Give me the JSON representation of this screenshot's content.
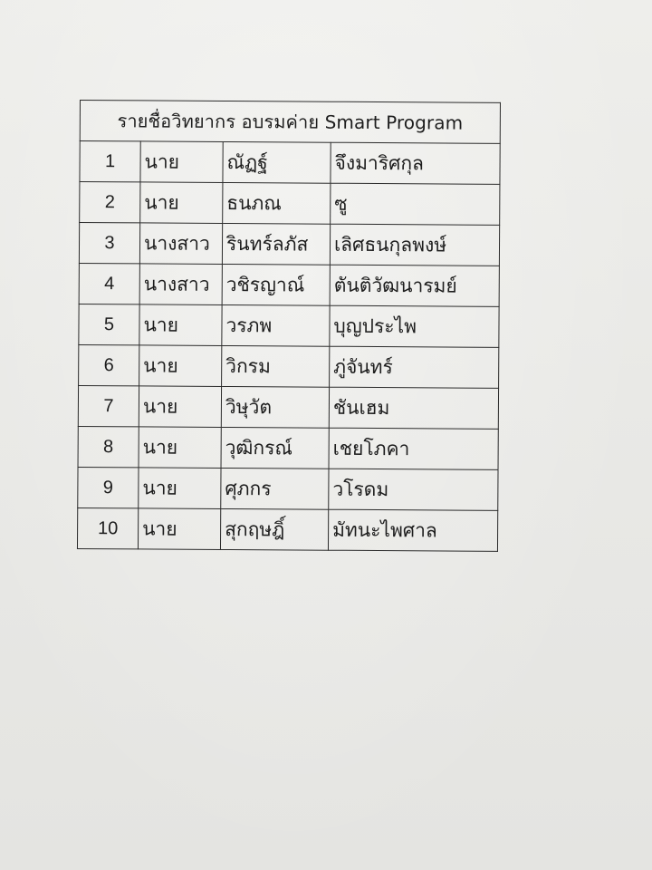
{
  "document": {
    "title": "รายชื่อวิทยากร อบรมค่าย Smart Program",
    "rows": [
      {
        "no": "1",
        "prefix": "นาย",
        "first_name": "ณัฏฐ์",
        "last_name": "จึงมาริศกุล"
      },
      {
        "no": "2",
        "prefix": "นาย",
        "first_name": "ธนภณ",
        "last_name": "ซู"
      },
      {
        "no": "3",
        "prefix": "นางสาว",
        "first_name": "รินทร์ลภัส",
        "last_name": "เลิศธนกุลพงษ์"
      },
      {
        "no": "4",
        "prefix": "นางสาว",
        "first_name": "วชิรญาณ์",
        "last_name": "ตันติวัฒนารมย์"
      },
      {
        "no": "5",
        "prefix": "นาย",
        "first_name": "วรภพ",
        "last_name": "บุญประไพ"
      },
      {
        "no": "6",
        "prefix": "นาย",
        "first_name": "วิกรม",
        "last_name": "ภู่จันทร์"
      },
      {
        "no": "7",
        "prefix": "นาย",
        "first_name": "วิษุวัต",
        "last_name": "ชันเฮม"
      },
      {
        "no": "8",
        "prefix": "นาย",
        "first_name": "วุฒิกรณ์",
        "last_name": "เชยโภคา"
      },
      {
        "no": "9",
        "prefix": "นาย",
        "first_name": "ศุภกร",
        "last_name": "วโรดม"
      },
      {
        "no": "10",
        "prefix": "นาย",
        "first_name": "สุกฤษฎิ์",
        "last_name": "มัทนะไพศาล"
      }
    ]
  }
}
